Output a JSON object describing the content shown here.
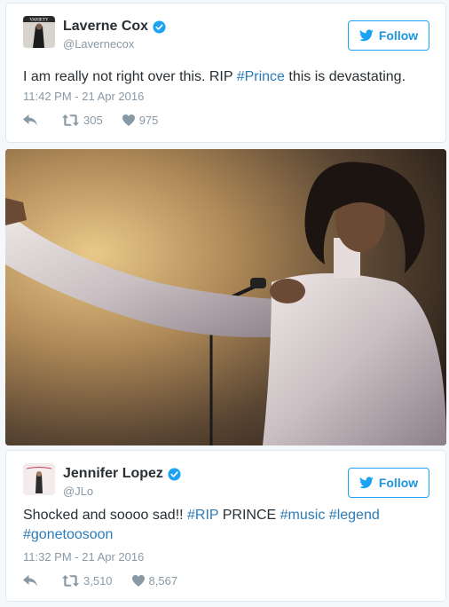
{
  "tweets": [
    {
      "display_name": "Laverne Cox",
      "handle": "@Lavernecox",
      "follow_label": "Follow",
      "text_plain": "I am really not right over this. RIP ",
      "hashtag_1": "#Prince",
      "text_after": " this is devastating.",
      "timestamp": "11:42 PM - 21 Apr 2016",
      "retweets": "305",
      "likes": "975",
      "avatar_label": "VARIETY"
    },
    {
      "display_name": "Jennifer Lopez",
      "handle": "@JLo",
      "follow_label": "Follow",
      "text_plain": "Shocked and soooo sad!! ",
      "hashtag_rip": "#RIP",
      "text_mid": " PRINCE ",
      "hashtag_music": "#music",
      "hashtag_legend": "#legend",
      "hashtag_gone": "#gonetoosoon",
      "timestamp": "11:32 PM - 21 Apr 2016",
      "retweets": "3,510",
      "likes": "8,567"
    }
  ],
  "colors": {
    "link": "#2b7bb9",
    "follow_blue": "#1da1f2",
    "meta_gray": "#8899a6",
    "verified_blue": "#1da1f2"
  },
  "icons": {
    "reply": "reply-icon",
    "retweet": "retweet-icon",
    "like": "heart-icon",
    "verified": "verified-badge-icon",
    "bird": "twitter-bird-icon"
  }
}
